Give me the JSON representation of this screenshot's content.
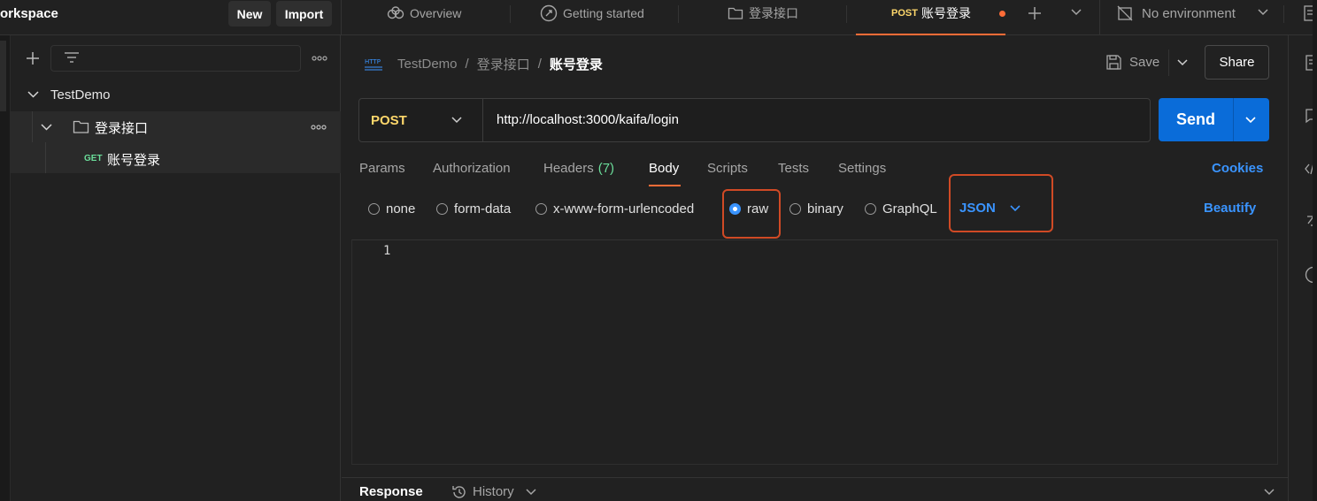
{
  "topbar": {
    "workspace_title": "orkspace",
    "new_label": "New",
    "import_label": "Import",
    "tabs": [
      {
        "label": "Overview",
        "icon": "overview-icon"
      },
      {
        "label": "Getting started",
        "icon": "getting-started-icon"
      },
      {
        "label": "登录接口",
        "icon": "folder-icon"
      },
      {
        "method": "POST",
        "label": "账号登录",
        "active": true,
        "unsaved": true
      }
    ],
    "environment": "No environment"
  },
  "sidebar": {
    "collection": "TestDemo",
    "folder": "登录接口",
    "request_method": "GET",
    "request_name": "账号登录"
  },
  "request": {
    "breadcrumb": [
      "TestDemo",
      "登录接口",
      "账号登录"
    ],
    "save_label": "Save",
    "share_label": "Share",
    "method": "POST",
    "url": "http://localhost:3000/kaifa/login",
    "send_label": "Send",
    "tabs": [
      {
        "label": "Params"
      },
      {
        "label": "Authorization"
      },
      {
        "label": "Headers",
        "count": "(7)"
      },
      {
        "label": "Body",
        "active": true
      },
      {
        "label": "Scripts"
      },
      {
        "label": "Tests"
      },
      {
        "label": "Settings"
      }
    ],
    "cookies_label": "Cookies",
    "body_options": [
      "none",
      "form-data",
      "x-www-form-urlencoded",
      "raw",
      "binary",
      "GraphQL"
    ],
    "selected_body_option": "raw",
    "format": "JSON",
    "beautify_label": "Beautify",
    "editor_line_number": "1"
  },
  "response": {
    "label": "Response",
    "history_label": "History"
  },
  "colors": {
    "accent": "#0a6cd9",
    "post_method": "#ffd86b",
    "get_method": "#6bdd9a",
    "link_blue": "#3a94ff",
    "highlight_border": "#d04a25",
    "unsaved_dot": "#ff6c37"
  }
}
